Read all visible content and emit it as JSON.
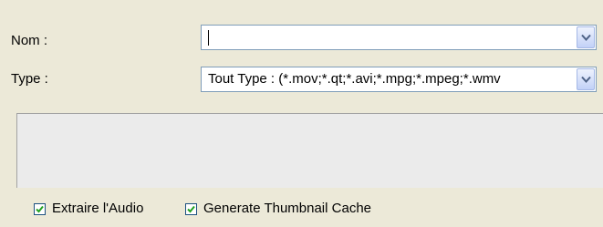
{
  "name_field": {
    "label": "Nom :",
    "value": ""
  },
  "type_field": {
    "label": "Type :",
    "value": "Tout Type : (*.mov;*.qt;*.avi;*.mpg;*.mpeg;*.wmv"
  },
  "options": {
    "extract_audio": {
      "label": "Extraire l'Audio",
      "checked": true
    },
    "thumbnail_cache": {
      "label": "Generate Thumbnail Cache",
      "checked": true
    }
  },
  "colors": {
    "window_bg": "#ece9d8",
    "field_border": "#7f9db9",
    "checkbox_border": "#1c5180",
    "check_mark": "#21a121"
  },
  "icons": {
    "dropdown": "chevron-down-icon",
    "check": "checkmark-icon"
  }
}
